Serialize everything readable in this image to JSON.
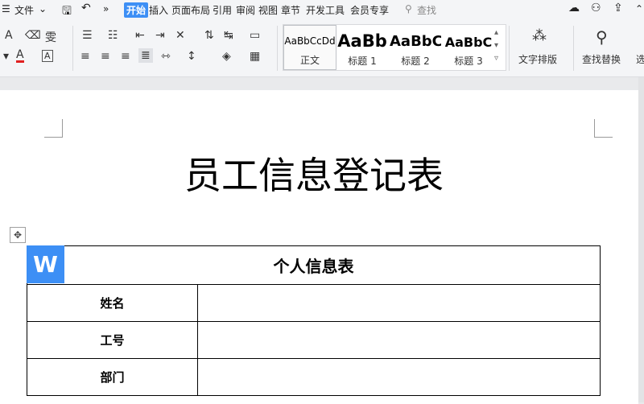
{
  "menubar": {
    "file_label": "文件",
    "tabs": [
      "开始",
      "插入",
      "页面布局",
      "引用",
      "审阅",
      "视图",
      "章节",
      "开发工具",
      "会员专享"
    ],
    "search_label": "查找"
  },
  "ribbon": {
    "style_gallery": [
      {
        "sample": "AaBbCcDd",
        "name": "正文"
      },
      {
        "sample": "AaBb",
        "name": "标题 1"
      },
      {
        "sample": "AaBbC",
        "name": "标题 2"
      },
      {
        "sample": "AaBbC",
        "name": "标题 3"
      }
    ],
    "text_layout_label": "文字排版",
    "find_replace_label": "查找替换",
    "select_label": "选"
  },
  "document": {
    "title": "员工信息登记表",
    "table": {
      "header": "个人信息表",
      "rows": [
        {
          "label": "姓名",
          "value": ""
        },
        {
          "label": "工号",
          "value": ""
        },
        {
          "label": "部门",
          "value": ""
        }
      ]
    }
  },
  "colors": {
    "accent": "#3d8ff5",
    "font_color_underline": "#e02020"
  },
  "icons": [
    "menu-icon",
    "save-icon",
    "undo-icon",
    "more-icon",
    "search-icon",
    "cloud-sync-icon",
    "share-user-icon",
    "collapse-icon"
  ]
}
